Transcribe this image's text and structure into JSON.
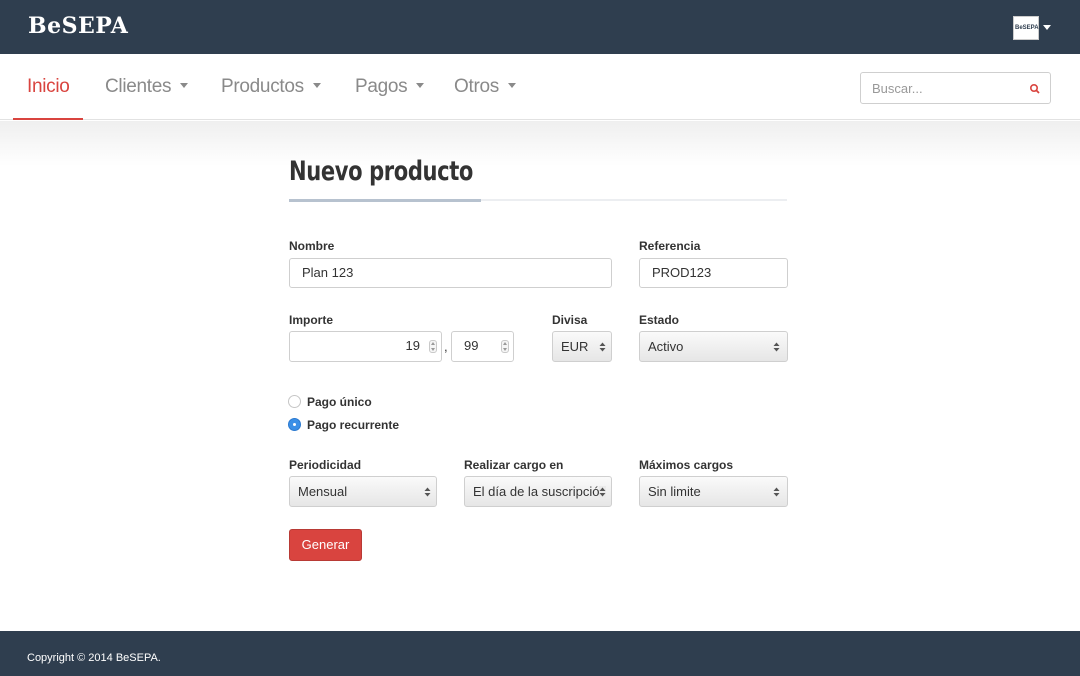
{
  "header": {
    "brand": "BeSEPA",
    "account_logo": "BeSEPA"
  },
  "nav": {
    "items": [
      {
        "label": "Inicio",
        "active": true
      },
      {
        "label": "Clientes"
      },
      {
        "label": "Productos"
      },
      {
        "label": "Pagos"
      },
      {
        "label": "Otros"
      }
    ],
    "search_placeholder": "Buscar..."
  },
  "form": {
    "title": "Nuevo producto",
    "nombre": {
      "label": "Nombre",
      "value": "Plan 123"
    },
    "referencia": {
      "label": "Referencia",
      "value": "PROD123"
    },
    "importe": {
      "label": "Importe",
      "integer": "19",
      "separator": ",",
      "decimals": "99"
    },
    "divisa": {
      "label": "Divisa",
      "value": "EUR"
    },
    "estado": {
      "label": "Estado",
      "value": "Activo"
    },
    "payment_type": {
      "options": [
        {
          "label": "Pago único",
          "checked": false
        },
        {
          "label": "Pago recurrente",
          "checked": true
        }
      ]
    },
    "periodicidad": {
      "label": "Periodicidad",
      "value": "Mensual"
    },
    "realizar_cargo": {
      "label": "Realizar cargo en",
      "value": "El día de la suscripción"
    },
    "maximos_cargos": {
      "label": "Máximos cargos",
      "value": "Sin limite"
    },
    "submit_label": "Generar"
  },
  "footer": {
    "copyright": "Copyright © 2014 BeSEPA."
  },
  "colors": {
    "header_bg": "#2f3e4f",
    "accent": "#d9443f",
    "radio_checked": "#3b8fe6"
  },
  "icons": {
    "search": "search-icon",
    "select": "select-arrows-icon",
    "account": "caret-down-icon"
  }
}
